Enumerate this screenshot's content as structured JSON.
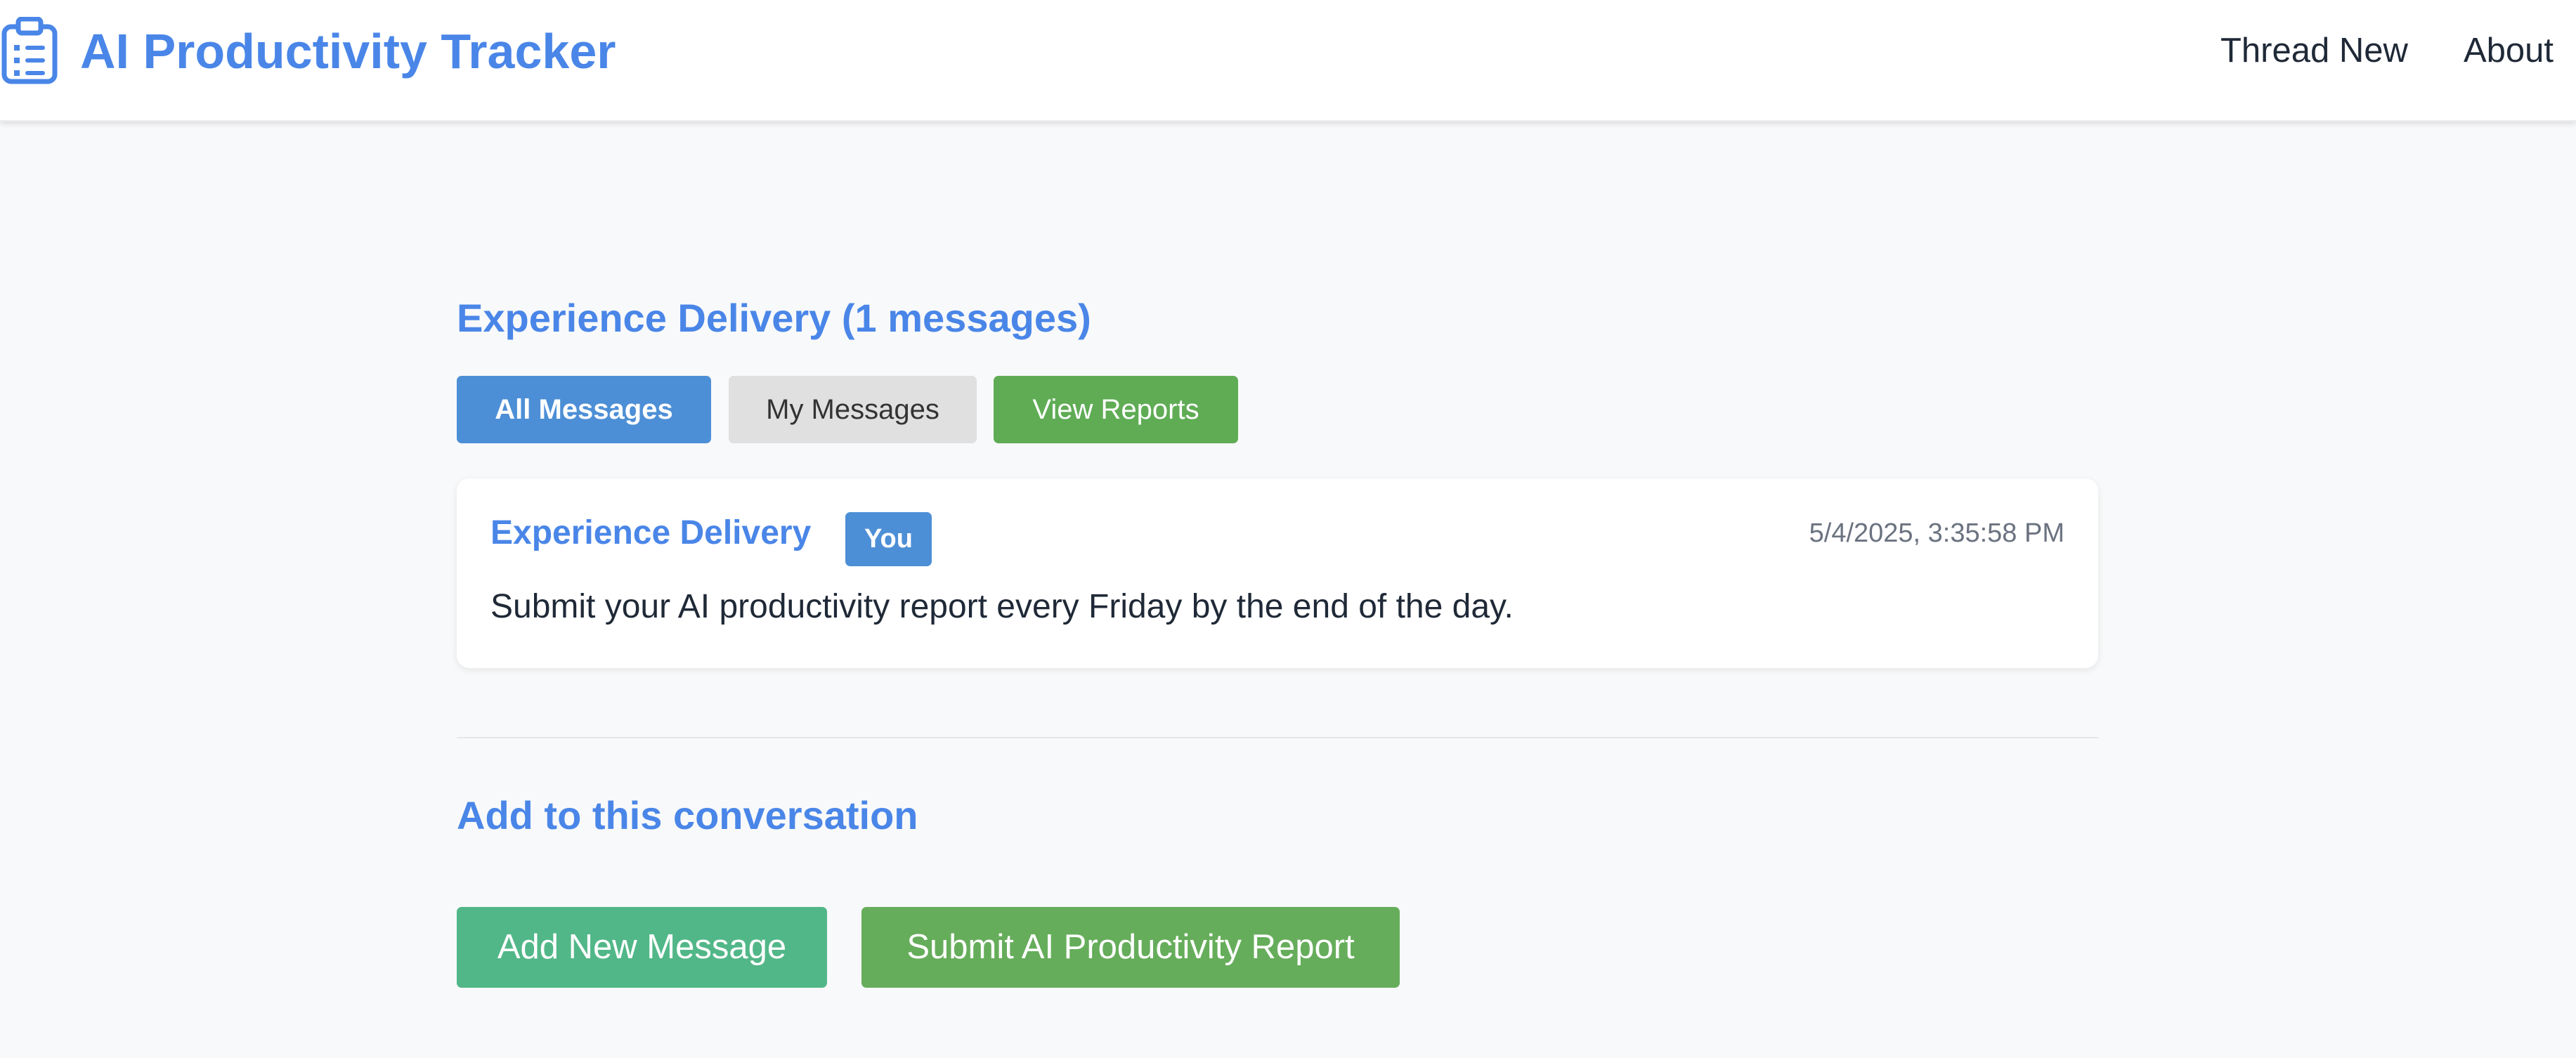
{
  "header": {
    "title": "AI Productivity Tracker",
    "logo_icon": "clipboard-list-icon",
    "nav": {
      "thread_new": "Thread New",
      "about": "About"
    }
  },
  "thread": {
    "title": "Experience Delivery (1 messages)",
    "filters": {
      "all": "All Messages",
      "mine": "My Messages",
      "reports": "View Reports"
    },
    "messages": [
      {
        "author": "Experience Delivery",
        "badge": "You",
        "timestamp": "5/4/2025, 3:35:58 PM",
        "text": "Submit your AI productivity report every Friday by the end of the day."
      }
    ]
  },
  "compose": {
    "heading": "Add to this conversation",
    "add_message": "Add New Message",
    "submit_report": "Submit AI Productivity Report"
  },
  "colors": {
    "accent": "#4a86e8",
    "primary_button": "#4d8fd6",
    "secondary_button": "#e0e0e0",
    "reports_button": "#5fac55",
    "add_button": "#52b788",
    "submit_button": "#66ad5b",
    "background": "#f8f9fa"
  }
}
